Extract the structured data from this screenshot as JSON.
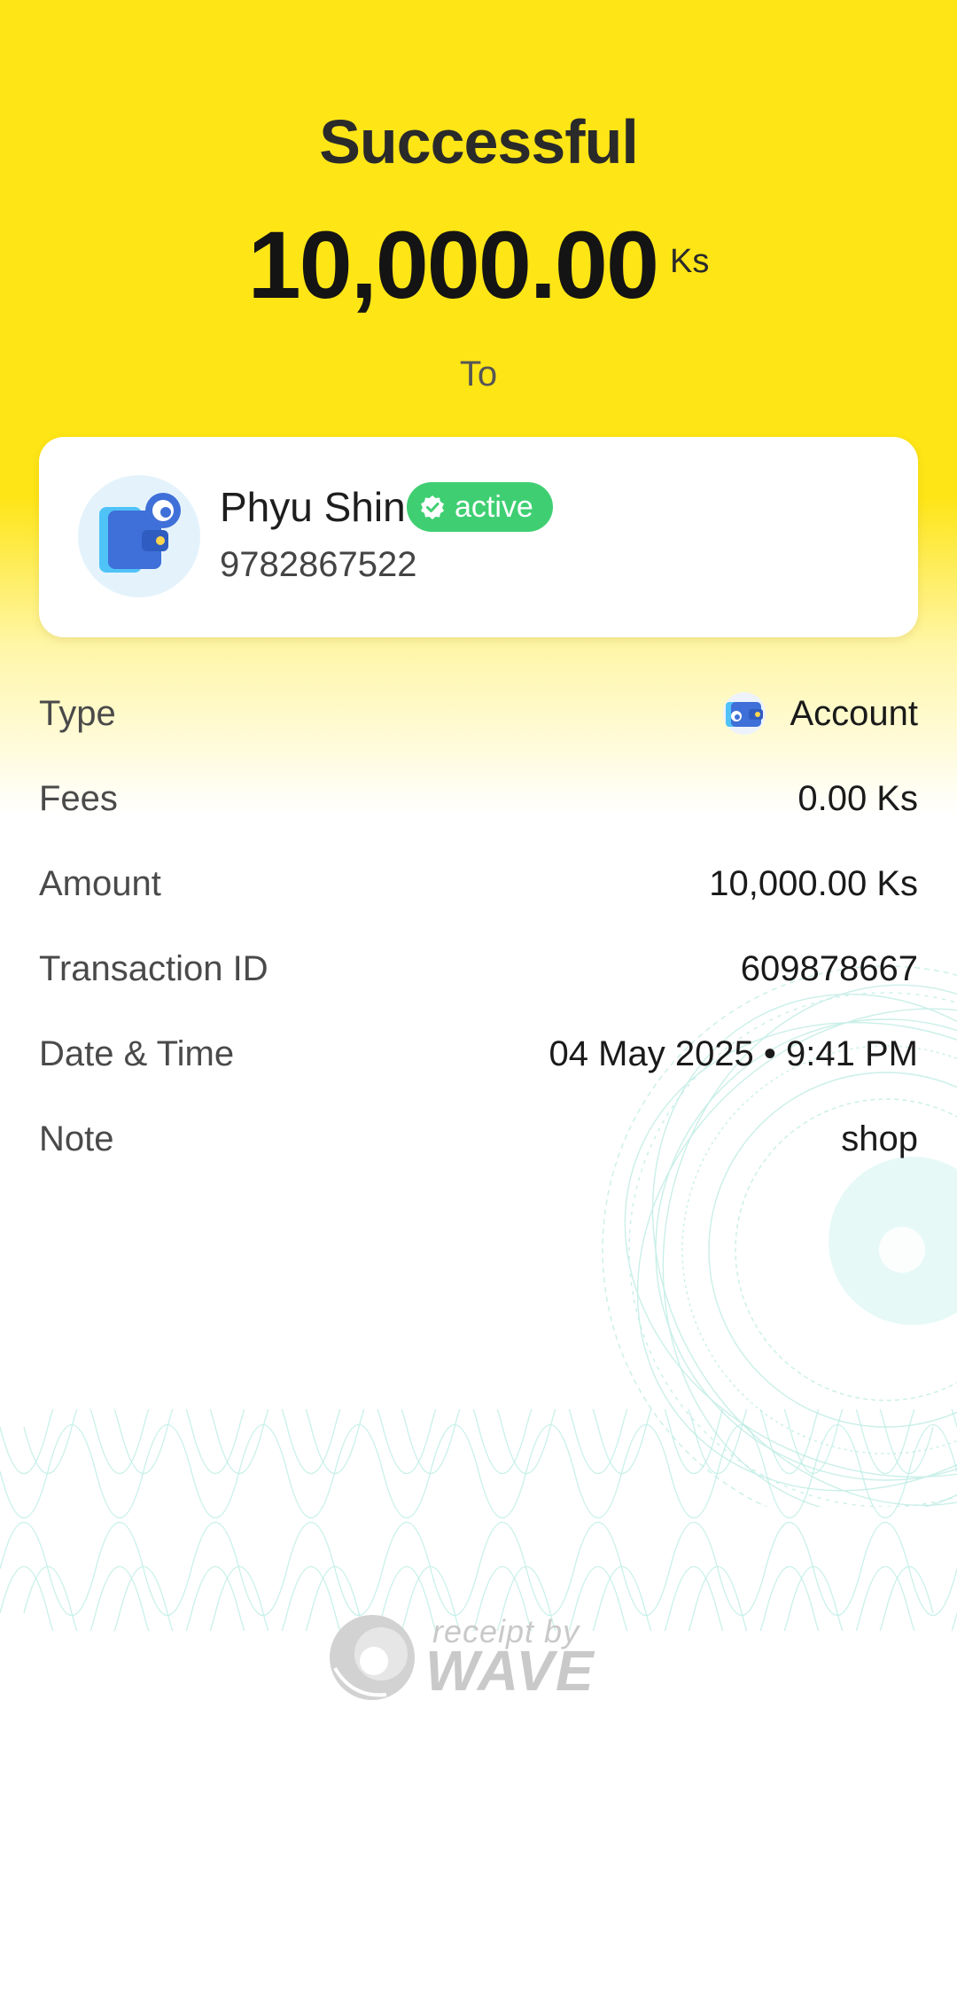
{
  "header": {
    "status_title": "Successful",
    "amount": "10,000.00",
    "currency": "Ks",
    "to_label": "To"
  },
  "recipient": {
    "name": "Phyu Shin",
    "badge": "active",
    "phone": "9782867522",
    "avatar_icon": "wallet-icon",
    "badge_icon": "verified-check-icon"
  },
  "details": [
    {
      "label": "Type",
      "value": "Account",
      "icon": "wallet-icon"
    },
    {
      "label": "Fees",
      "value": "0.00 Ks"
    },
    {
      "label": "Amount",
      "value": "10,000.00 Ks"
    },
    {
      "label": "Transaction ID",
      "value": "609878667"
    },
    {
      "label": "Date & Time",
      "value": "04 May 2025 • 9:41 PM"
    },
    {
      "label": "Note",
      "value": "shop"
    }
  ],
  "footer": {
    "receipt_by": "receipt by",
    "brand": "WAVE",
    "logo_icon": "wave-logo-icon"
  },
  "colors": {
    "header_yellow": "#fee516",
    "badge_green": "#3fcf72",
    "guilloche_teal": "#9fe3d6"
  }
}
